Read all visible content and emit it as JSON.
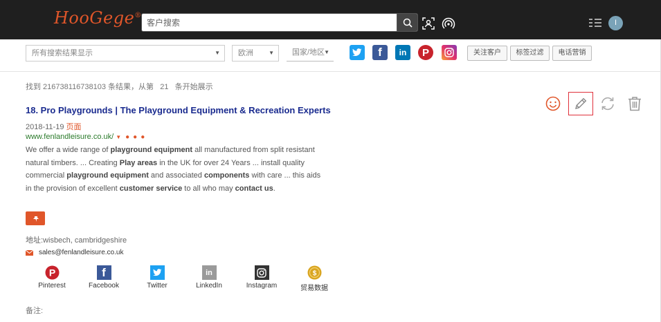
{
  "header": {
    "logo": "HooGege",
    "logo_mark": "®",
    "search_placeholder": "客户搜索",
    "avatar_letter": "I"
  },
  "filters": {
    "display_select": "所有搜索结果显示",
    "region_select": "欧洲",
    "country_select": "国家/地区"
  },
  "toolbar_buttons": [
    "关注客户",
    "标签过滤",
    "电话营销"
  ],
  "results": {
    "count_text": "找到 216738116738103 条结果，从第",
    "start_number": "21",
    "count_suffix": "条开始展示"
  },
  "result": {
    "title": "18. Pro Playgrounds | The Playground Equipment & Recreation Experts",
    "date": "2018-11-19",
    "snapshot": "页面",
    "url": "www.fenlandleisure.co.uk/",
    "snippet_parts": [
      {
        "t": "We offer a wide range of ",
        "b": false
      },
      {
        "t": "playground equipment",
        "b": true
      },
      {
        "t": " all manufactured from split resistant natural timbers. ... Creating ",
        "b": false
      },
      {
        "t": "Play areas",
        "b": true
      },
      {
        "t": " in the UK for over 24 Years ... install quality commercial ",
        "b": false
      },
      {
        "t": "playground equipment",
        "b": true
      },
      {
        "t": " and associated ",
        "b": false
      },
      {
        "t": "components",
        "b": true
      },
      {
        "t": " with care ... this aids in the provision of excellent ",
        "b": false
      },
      {
        "t": "customer service",
        "b": true
      },
      {
        "t": " to all who may ",
        "b": false
      },
      {
        "t": "contact us",
        "b": true
      },
      {
        "t": ".",
        "b": false
      }
    ],
    "address": "地址:wisbech, cambridgeshire",
    "email": "sales@fenlandleisure.co.uk",
    "note_label": "备注:"
  },
  "social_links": [
    {
      "label": "Pinterest",
      "color": "#c8232c"
    },
    {
      "label": "Facebook",
      "color": "#3b5998"
    },
    {
      "label": "Twitter",
      "color": "#1da1f2"
    },
    {
      "label": "LinkedIn",
      "color": "#9a9a9a"
    },
    {
      "label": "Instagram",
      "color": "#333333"
    },
    {
      "label": "贸易数据",
      "color": "#d9a520"
    }
  ],
  "colors": {
    "brand": "#e0562a",
    "link_title": "#1a2b8f",
    "url_green": "#2a7a2a",
    "topbar": "#1f1f1f"
  }
}
